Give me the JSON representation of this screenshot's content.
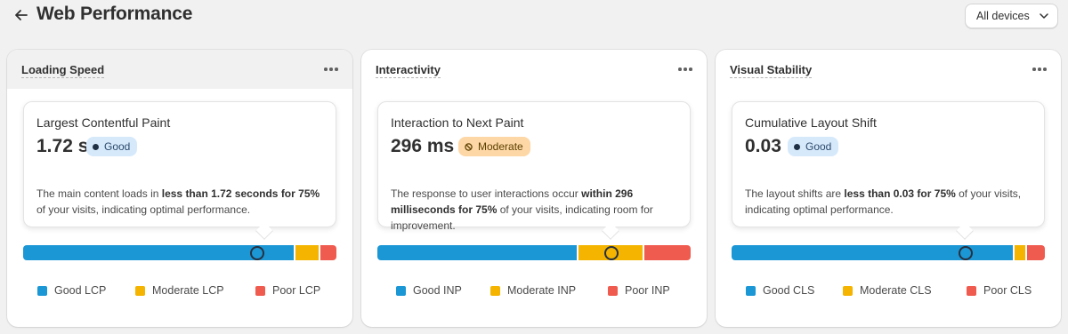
{
  "header": {
    "title": "Web Performance",
    "back_icon": "arrow-left-icon",
    "device_select": "All devices"
  },
  "colors": {
    "good": "#1b97d6",
    "moderate": "#f4b400",
    "poor": "#f05b4f",
    "good_badge_bg": "#d6e9fb",
    "moderate_badge_bg": "#fdd7a6"
  },
  "cards": [
    {
      "title": "Loading Speed",
      "metric_name": "Largest Contentful Paint",
      "value": "1.72 s",
      "status": "Good",
      "desc_pre": "The main content loads in ",
      "desc_bold": "less than 1.72 seconds for 75%",
      "desc_post": " of your visits, indicating optimal performance.",
      "distribution": {
        "good": 0.875,
        "moderate": 0.075,
        "poor": 0.05
      },
      "p75_position": 0.748,
      "legend": [
        "Good LCP",
        "Moderate LCP",
        "Poor LCP"
      ]
    },
    {
      "title": "Interactivity",
      "metric_name": "Interaction to Next Paint",
      "value": "296 ms",
      "status": "Moderate",
      "desc_pre": "The response to user interactions occur ",
      "desc_bold": "within 296 milliseconds for 75%",
      "desc_post": " of your visits, indicating room for improvement.",
      "distribution": {
        "good": 0.64,
        "moderate": 0.205,
        "poor": 0.145
      },
      "p75_position": 0.745,
      "legend": [
        "Good INP",
        "Moderate INP",
        "Poor INP"
      ]
    },
    {
      "title": "Visual Stability",
      "metric_name": "Cumulative Layout Shift",
      "value": "0.03",
      "status": "Good",
      "desc_pre": "The layout shifts are ",
      "desc_bold": "less than 0.03 for 75%",
      "desc_post": " of your visits, indicating optimal performance.",
      "distribution": {
        "good": 0.905,
        "moderate": 0.035,
        "poor": 0.055
      },
      "p75_position": 0.748,
      "legend": [
        "Good CLS",
        "Moderate CLS",
        "Poor CLS"
      ]
    }
  ]
}
